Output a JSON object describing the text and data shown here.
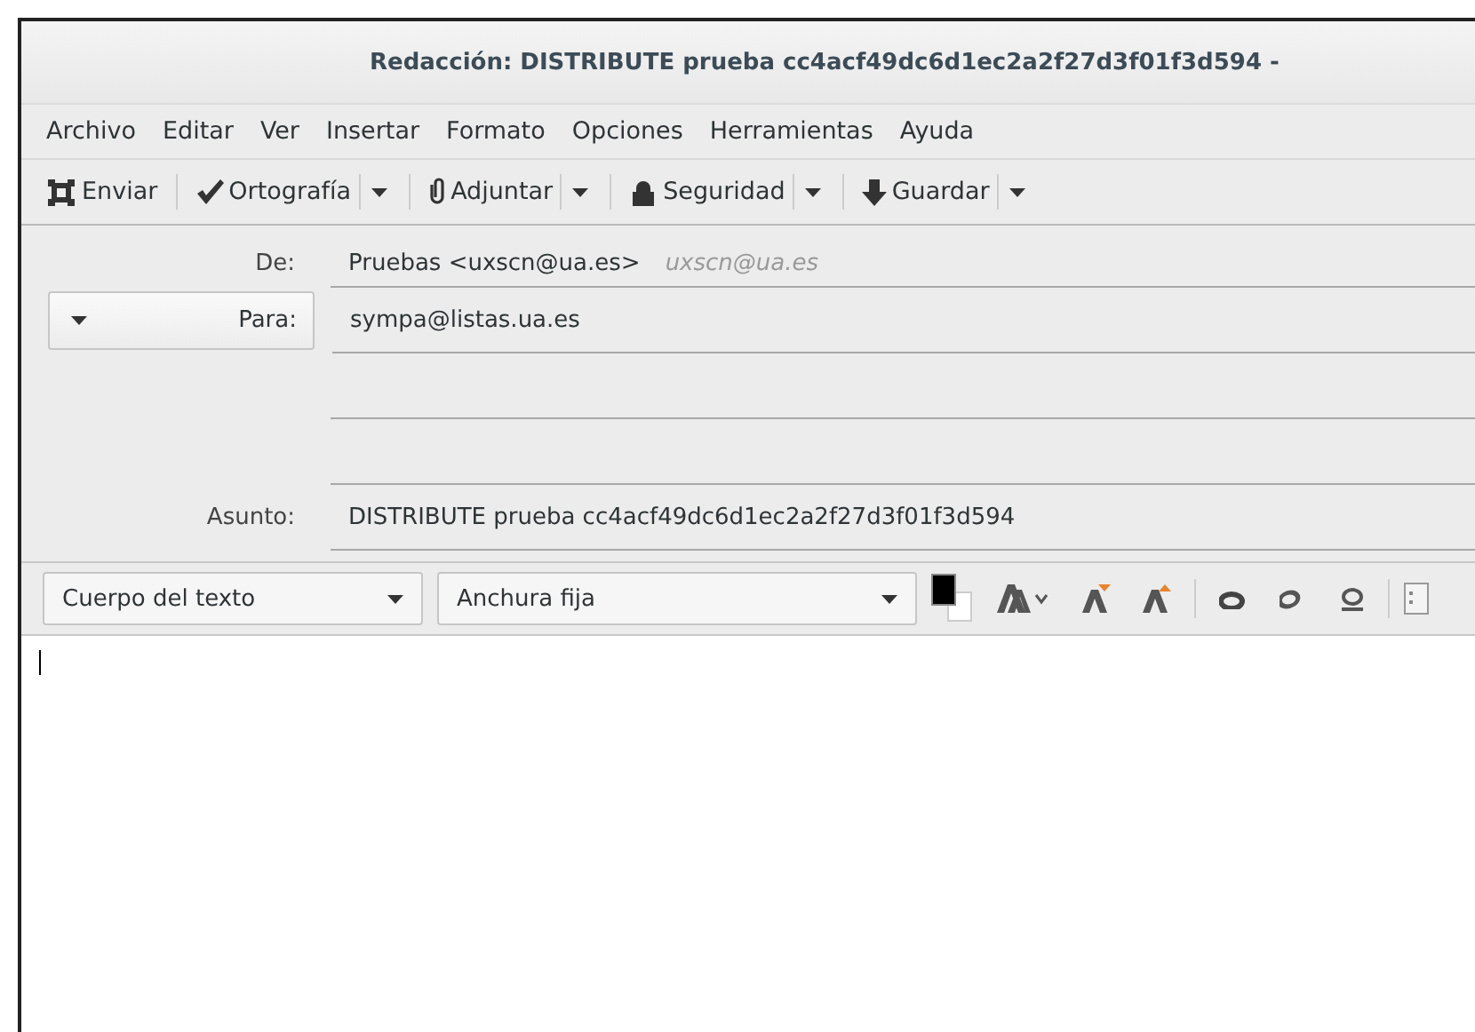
{
  "window": {
    "title": "Redacción: DISTRIBUTE prueba cc4acf49dc6d1ec2a2f27d3f01f3d594 -"
  },
  "menu": [
    {
      "label": "Archivo"
    },
    {
      "label": "Editar"
    },
    {
      "label": "Ver"
    },
    {
      "label": "Insertar"
    },
    {
      "label": "Formato"
    },
    {
      "label": "Opciones"
    },
    {
      "label": "Herramientas"
    },
    {
      "label": "Ayuda"
    }
  ],
  "toolbar": [
    {
      "label": "Enviar",
      "kind": "send",
      "dropdown": false
    },
    {
      "label": "Ortografía",
      "kind": "spelling",
      "dropdown": true
    },
    {
      "label": "Adjuntar",
      "kind": "attach",
      "dropdown": true
    },
    {
      "label": "Seguridad",
      "kind": "security",
      "dropdown": true
    },
    {
      "label": "Guardar",
      "kind": "save",
      "dropdown": true
    }
  ],
  "header": {
    "from": {
      "label": "De:",
      "value": "Pruebas <uxscn@ua.es>",
      "hint": "uxscn@ua.es"
    },
    "recipients": [
      {
        "type": "Para:",
        "value": "sympa@listas.ua.es"
      }
    ],
    "subject": {
      "label": "Asunto:",
      "value": "DISTRIBUTE prueba cc4acf49dc6d1ec2a2f27d3f01f3d594"
    }
  },
  "format_bar": {
    "paragraph": "Cuerpo del texto",
    "font": "Anchura fija"
  }
}
